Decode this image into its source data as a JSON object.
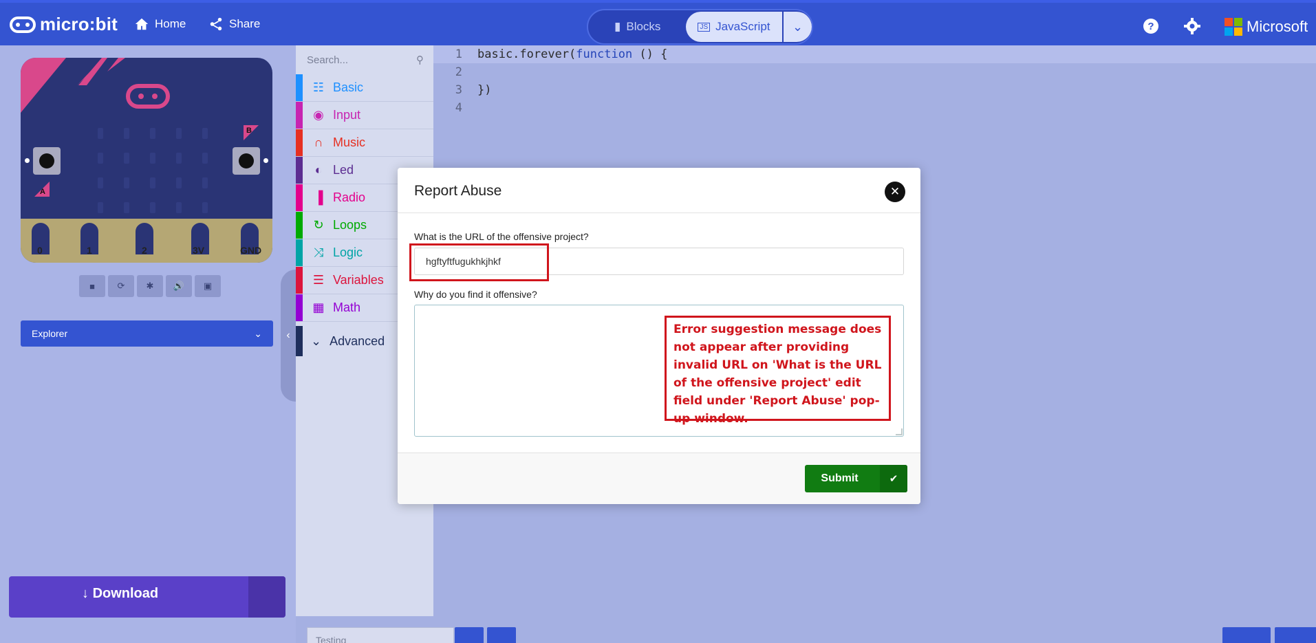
{
  "header": {
    "brand": "micro:bit",
    "nav": [
      {
        "label": "Home",
        "icon": "home-icon"
      },
      {
        "label": "Share",
        "icon": "share-icon"
      }
    ],
    "modes": {
      "blocks": "Blocks",
      "javascript": "JavaScript",
      "active": "javascript"
    },
    "right": {
      "microsoft": "Microsoft"
    },
    "colors": {
      "bar": "#3454d1",
      "accent": "#dbe2fb"
    }
  },
  "simulator": {
    "pins": [
      "0",
      "1",
      "2",
      "3V",
      "GND"
    ],
    "buttons": [
      "A",
      "B"
    ],
    "toolbar": [
      "stop-icon",
      "restart-icon",
      "debug-icon",
      "mute-icon",
      "fullscreen-icon"
    ],
    "explorer_label": "Explorer"
  },
  "toolbox": {
    "search_placeholder": "Search...",
    "categories": [
      {
        "label": "Basic",
        "color": "#1e90ff",
        "icon": "grid-icon"
      },
      {
        "label": "Input",
        "color": "#c724b1",
        "icon": "target-icon"
      },
      {
        "label": "Music",
        "color": "#e63022",
        "icon": "headphones-icon"
      },
      {
        "label": "Led",
        "color": "#5c2d91",
        "icon": "toggle-icon"
      },
      {
        "label": "Radio",
        "color": "#e3008c",
        "icon": "signal-icon"
      },
      {
        "label": "Loops",
        "color": "#00aa00",
        "icon": "refresh-icon"
      },
      {
        "label": "Logic",
        "color": "#00a4a6",
        "icon": "shuffle-icon"
      },
      {
        "label": "Variables",
        "color": "#dc143c",
        "icon": "list-icon"
      },
      {
        "label": "Math",
        "color": "#9400d3",
        "icon": "calculator-icon"
      }
    ],
    "advanced": "Advanced"
  },
  "editor": {
    "lines": [
      {
        "num": "1",
        "pre": "basic.forever(",
        "kw": "function",
        "post": " () {"
      },
      {
        "num": "2",
        "pre": "",
        "kw": "",
        "post": ""
      },
      {
        "num": "3",
        "pre": "})",
        "kw": "",
        "post": ""
      },
      {
        "num": "4",
        "pre": "",
        "kw": "",
        "post": ""
      }
    ]
  },
  "footer": {
    "download": "Download",
    "project_name": "Testing"
  },
  "modal": {
    "title": "Report Abuse",
    "url_label": "What is the URL of the offensive project?",
    "url_value": "hgftyftfugukhkjhkf",
    "reason_label": "Why do you find it offensive?",
    "reason_value": "",
    "submit": "Submit",
    "annotation": "Error suggestion message does not appear after providing invalid URL on 'What is the URL of the offensive project' edit field under 'Report Abuse' pop-up window."
  }
}
